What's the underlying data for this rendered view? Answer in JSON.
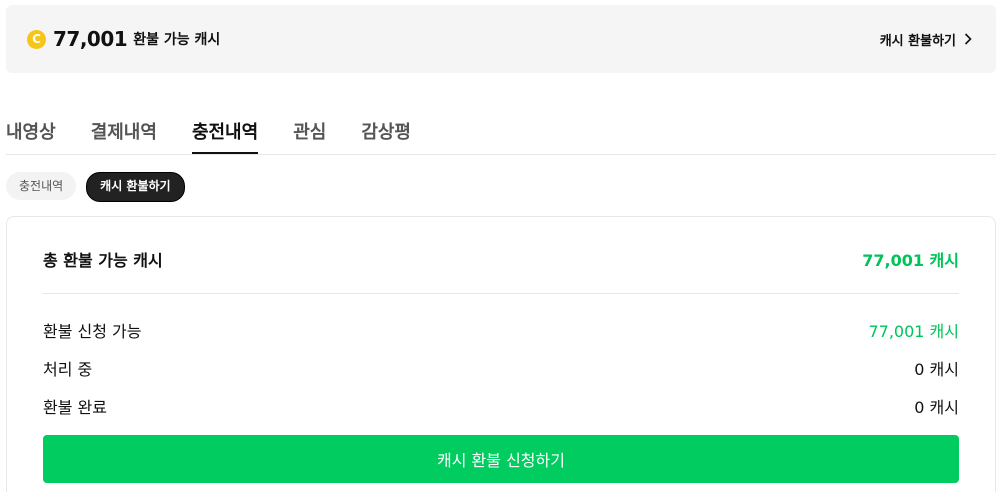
{
  "cash_bar": {
    "coin_icon": "coin-icon",
    "coin_letter": "C",
    "amount": "77,001",
    "caption": "환불 가능 캐시",
    "refund_link": "캐시 환불하기"
  },
  "tabs": [
    {
      "label": "내영상",
      "active": false
    },
    {
      "label": "결제내역",
      "active": false
    },
    {
      "label": "충전내역",
      "active": true
    },
    {
      "label": "관심",
      "active": false
    },
    {
      "label": "감상평",
      "active": false
    }
  ],
  "subtabs": [
    {
      "label": "충전내역",
      "active": false
    },
    {
      "label": "캐시 환불하기",
      "active": true
    }
  ],
  "refund_card": {
    "total_label": "총 환불 가능 캐시",
    "total_value": "77,001 캐시",
    "rows": [
      {
        "label": "환불 신청 가능",
        "value": "77,001 캐시"
      },
      {
        "label": "처리 중",
        "value": "0 캐시"
      },
      {
        "label": "환불 완료",
        "value": "0 캐시"
      }
    ],
    "apply_button": "캐시 환불 신청하기"
  },
  "colors": {
    "accent_green": "#00cc5f",
    "coin_yellow": "#f5c518"
  }
}
